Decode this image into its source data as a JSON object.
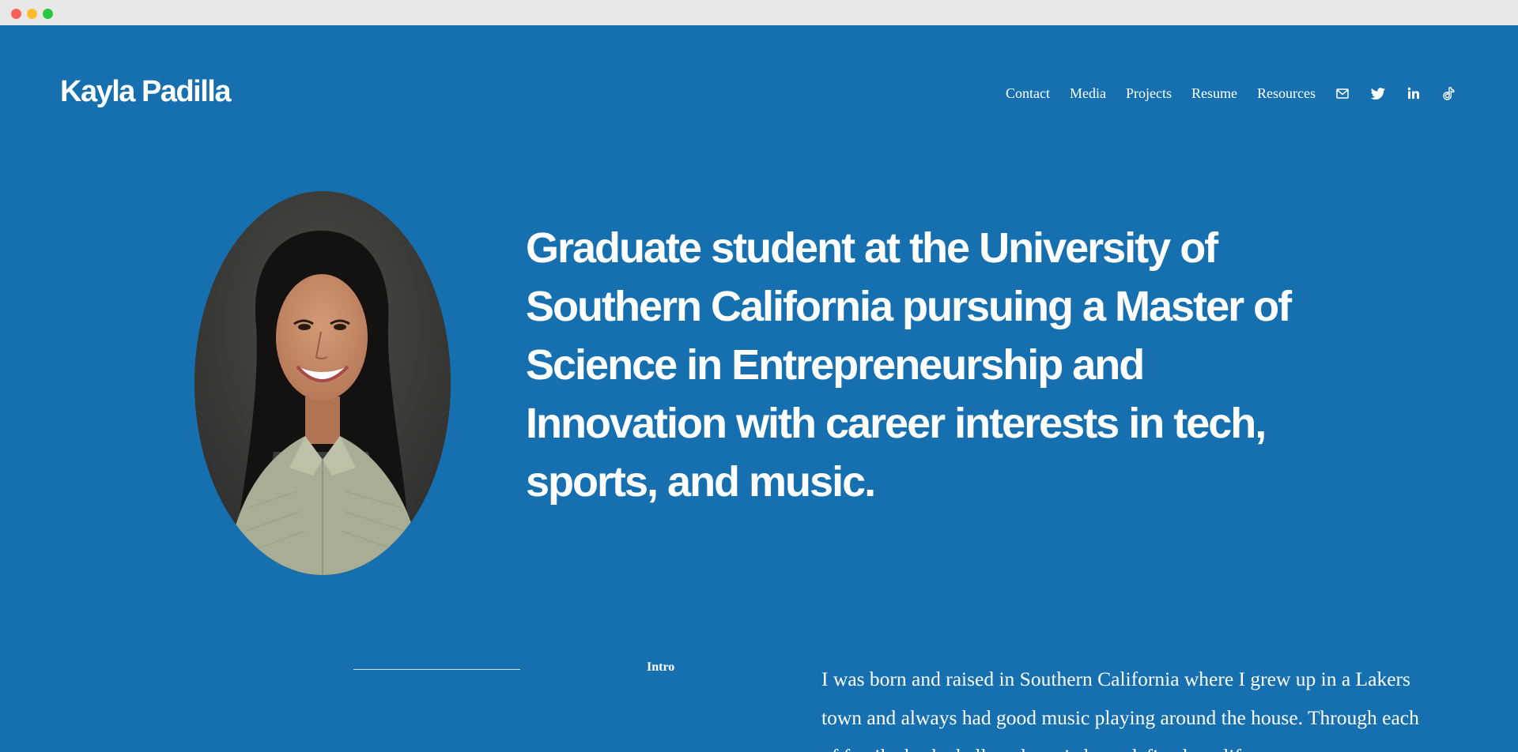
{
  "window": {
    "controls": [
      "close",
      "minimize",
      "maximize"
    ]
  },
  "site": {
    "brand": "Kayla Padilla"
  },
  "nav": {
    "links": [
      "Contact",
      "Media",
      "Projects",
      "Resume",
      "Resources"
    ],
    "icons": [
      "mail-icon",
      "twitter-icon",
      "linkedin-icon",
      "tiktok-icon"
    ]
  },
  "hero": {
    "portrait_icon": "portrait-photo",
    "headline": "Graduate student at the University of Southern California pursuing a Master of Science in Entrepreneurship and Innovation with career interests in tech, sports, and music."
  },
  "intro": {
    "label": "Intro",
    "text": "I was born and raised in Southern California where I grew up in a Lakers town and always had good music playing around the house. Through each of family, basketball, and music have defined my life"
  },
  "colors": {
    "background": "#1670b0",
    "text": "#ffffff"
  }
}
